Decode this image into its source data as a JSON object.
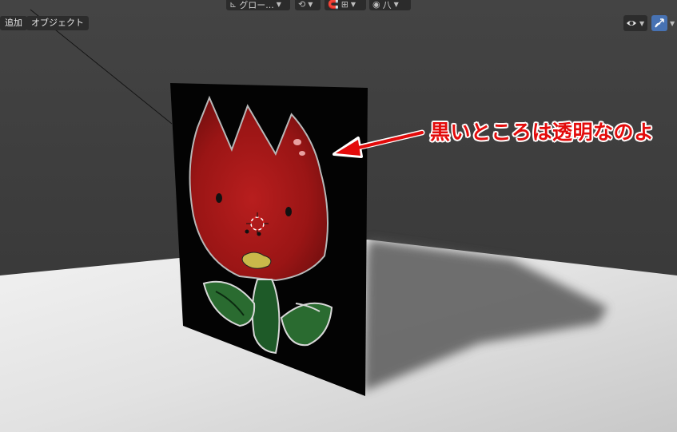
{
  "header": {
    "transform_orientation": "グロー...",
    "proportional_label": "八"
  },
  "menu": {
    "add_label": "追加",
    "object_label": "オブジェクト"
  },
  "annotation": {
    "text": "黒いところは透明なのよ",
    "color": "#e30b0b"
  },
  "icons": [
    "transform-orientation-icon",
    "pivot-icon",
    "snap-icon",
    "proportional-edit-icon",
    "visibility-icon",
    "gizmo-icon",
    "chevron-down-icon"
  ]
}
